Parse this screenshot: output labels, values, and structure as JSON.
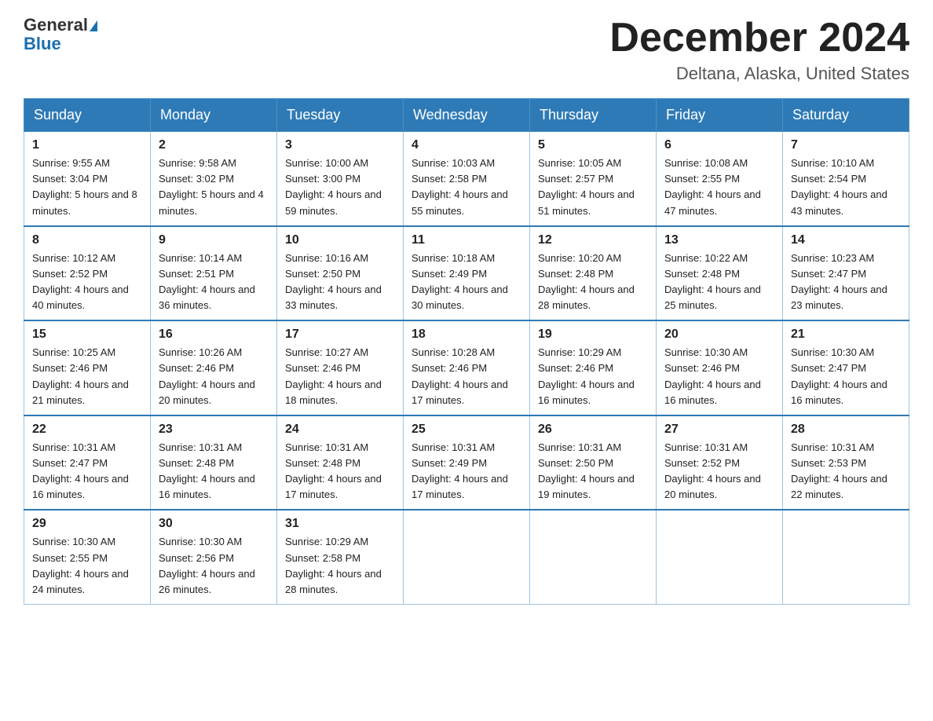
{
  "header": {
    "logo_general": "General",
    "logo_blue": "Blue",
    "month_title": "December 2024",
    "location": "Deltana, Alaska, United States"
  },
  "weekdays": [
    "Sunday",
    "Monday",
    "Tuesday",
    "Wednesday",
    "Thursday",
    "Friday",
    "Saturday"
  ],
  "weeks": [
    [
      {
        "day": "1",
        "sunrise": "Sunrise: 9:55 AM",
        "sunset": "Sunset: 3:04 PM",
        "daylight": "Daylight: 5 hours and 8 minutes."
      },
      {
        "day": "2",
        "sunrise": "Sunrise: 9:58 AM",
        "sunset": "Sunset: 3:02 PM",
        "daylight": "Daylight: 5 hours and 4 minutes."
      },
      {
        "day": "3",
        "sunrise": "Sunrise: 10:00 AM",
        "sunset": "Sunset: 3:00 PM",
        "daylight": "Daylight: 4 hours and 59 minutes."
      },
      {
        "day": "4",
        "sunrise": "Sunrise: 10:03 AM",
        "sunset": "Sunset: 2:58 PM",
        "daylight": "Daylight: 4 hours and 55 minutes."
      },
      {
        "day": "5",
        "sunrise": "Sunrise: 10:05 AM",
        "sunset": "Sunset: 2:57 PM",
        "daylight": "Daylight: 4 hours and 51 minutes."
      },
      {
        "day": "6",
        "sunrise": "Sunrise: 10:08 AM",
        "sunset": "Sunset: 2:55 PM",
        "daylight": "Daylight: 4 hours and 47 minutes."
      },
      {
        "day": "7",
        "sunrise": "Sunrise: 10:10 AM",
        "sunset": "Sunset: 2:54 PM",
        "daylight": "Daylight: 4 hours and 43 minutes."
      }
    ],
    [
      {
        "day": "8",
        "sunrise": "Sunrise: 10:12 AM",
        "sunset": "Sunset: 2:52 PM",
        "daylight": "Daylight: 4 hours and 40 minutes."
      },
      {
        "day": "9",
        "sunrise": "Sunrise: 10:14 AM",
        "sunset": "Sunset: 2:51 PM",
        "daylight": "Daylight: 4 hours and 36 minutes."
      },
      {
        "day": "10",
        "sunrise": "Sunrise: 10:16 AM",
        "sunset": "Sunset: 2:50 PM",
        "daylight": "Daylight: 4 hours and 33 minutes."
      },
      {
        "day": "11",
        "sunrise": "Sunrise: 10:18 AM",
        "sunset": "Sunset: 2:49 PM",
        "daylight": "Daylight: 4 hours and 30 minutes."
      },
      {
        "day": "12",
        "sunrise": "Sunrise: 10:20 AM",
        "sunset": "Sunset: 2:48 PM",
        "daylight": "Daylight: 4 hours and 28 minutes."
      },
      {
        "day": "13",
        "sunrise": "Sunrise: 10:22 AM",
        "sunset": "Sunset: 2:48 PM",
        "daylight": "Daylight: 4 hours and 25 minutes."
      },
      {
        "day": "14",
        "sunrise": "Sunrise: 10:23 AM",
        "sunset": "Sunset: 2:47 PM",
        "daylight": "Daylight: 4 hours and 23 minutes."
      }
    ],
    [
      {
        "day": "15",
        "sunrise": "Sunrise: 10:25 AM",
        "sunset": "Sunset: 2:46 PM",
        "daylight": "Daylight: 4 hours and 21 minutes."
      },
      {
        "day": "16",
        "sunrise": "Sunrise: 10:26 AM",
        "sunset": "Sunset: 2:46 PM",
        "daylight": "Daylight: 4 hours and 20 minutes."
      },
      {
        "day": "17",
        "sunrise": "Sunrise: 10:27 AM",
        "sunset": "Sunset: 2:46 PM",
        "daylight": "Daylight: 4 hours and 18 minutes."
      },
      {
        "day": "18",
        "sunrise": "Sunrise: 10:28 AM",
        "sunset": "Sunset: 2:46 PM",
        "daylight": "Daylight: 4 hours and 17 minutes."
      },
      {
        "day": "19",
        "sunrise": "Sunrise: 10:29 AM",
        "sunset": "Sunset: 2:46 PM",
        "daylight": "Daylight: 4 hours and 16 minutes."
      },
      {
        "day": "20",
        "sunrise": "Sunrise: 10:30 AM",
        "sunset": "Sunset: 2:46 PM",
        "daylight": "Daylight: 4 hours and 16 minutes."
      },
      {
        "day": "21",
        "sunrise": "Sunrise: 10:30 AM",
        "sunset": "Sunset: 2:47 PM",
        "daylight": "Daylight: 4 hours and 16 minutes."
      }
    ],
    [
      {
        "day": "22",
        "sunrise": "Sunrise: 10:31 AM",
        "sunset": "Sunset: 2:47 PM",
        "daylight": "Daylight: 4 hours and 16 minutes."
      },
      {
        "day": "23",
        "sunrise": "Sunrise: 10:31 AM",
        "sunset": "Sunset: 2:48 PM",
        "daylight": "Daylight: 4 hours and 16 minutes."
      },
      {
        "day": "24",
        "sunrise": "Sunrise: 10:31 AM",
        "sunset": "Sunset: 2:48 PM",
        "daylight": "Daylight: 4 hours and 17 minutes."
      },
      {
        "day": "25",
        "sunrise": "Sunrise: 10:31 AM",
        "sunset": "Sunset: 2:49 PM",
        "daylight": "Daylight: 4 hours and 17 minutes."
      },
      {
        "day": "26",
        "sunrise": "Sunrise: 10:31 AM",
        "sunset": "Sunset: 2:50 PM",
        "daylight": "Daylight: 4 hours and 19 minutes."
      },
      {
        "day": "27",
        "sunrise": "Sunrise: 10:31 AM",
        "sunset": "Sunset: 2:52 PM",
        "daylight": "Daylight: 4 hours and 20 minutes."
      },
      {
        "day": "28",
        "sunrise": "Sunrise: 10:31 AM",
        "sunset": "Sunset: 2:53 PM",
        "daylight": "Daylight: 4 hours and 22 minutes."
      }
    ],
    [
      {
        "day": "29",
        "sunrise": "Sunrise: 10:30 AM",
        "sunset": "Sunset: 2:55 PM",
        "daylight": "Daylight: 4 hours and 24 minutes."
      },
      {
        "day": "30",
        "sunrise": "Sunrise: 10:30 AM",
        "sunset": "Sunset: 2:56 PM",
        "daylight": "Daylight: 4 hours and 26 minutes."
      },
      {
        "day": "31",
        "sunrise": "Sunrise: 10:29 AM",
        "sunset": "Sunset: 2:58 PM",
        "daylight": "Daylight: 4 hours and 28 minutes."
      },
      null,
      null,
      null,
      null
    ]
  ]
}
